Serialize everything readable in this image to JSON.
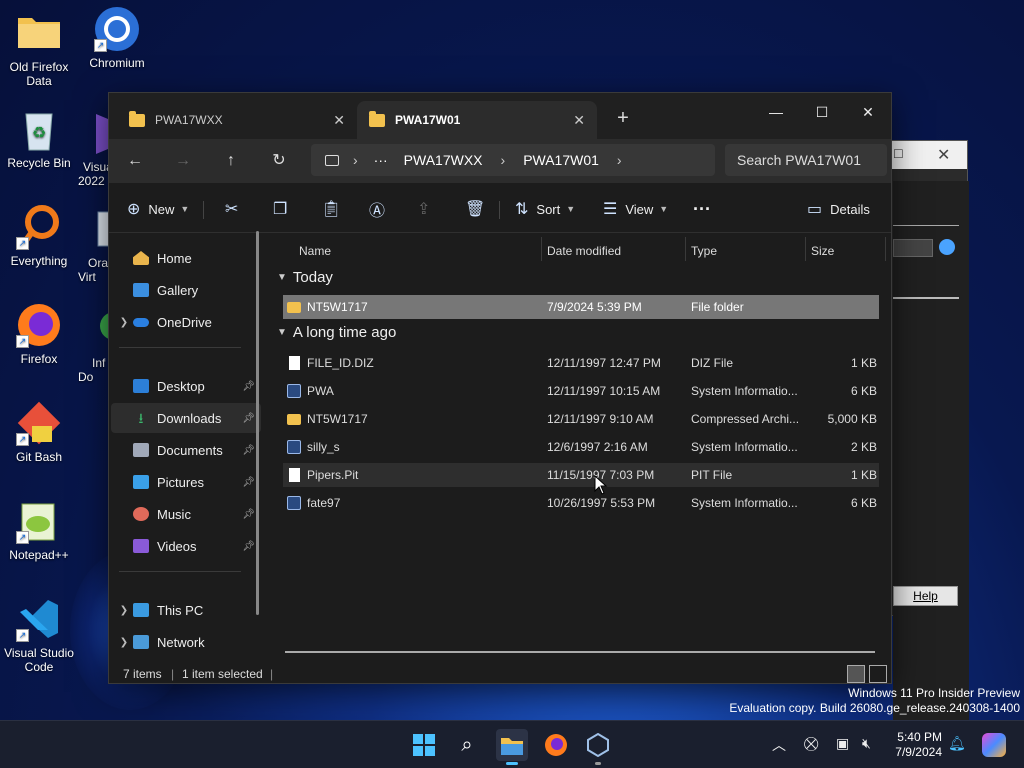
{
  "desktop": {
    "icons": [
      {
        "label": "Old Firefox Data",
        "icon": "folder-icon"
      },
      {
        "label": "Chromium",
        "icon": "chromium-icon"
      },
      {
        "label": "Recycle Bin",
        "icon": "recycle-bin-icon"
      },
      {
        "label": "Visua 2022",
        "icon": "visual-studio-icon"
      },
      {
        "label": "Everything",
        "icon": "everything-search-icon"
      },
      {
        "label": "Ora Virt",
        "icon": "virtualbox-icon"
      },
      {
        "label": "Firefox",
        "icon": "firefox-icon"
      },
      {
        "label": "Inf Do",
        "icon": "app-icon"
      },
      {
        "label": "Git Bash",
        "icon": "git-bash-icon"
      },
      {
        "label": "Notepad++",
        "icon": "notepad-plus-plus-icon"
      },
      {
        "label": "Visual Studio Code",
        "icon": "vscode-icon"
      }
    ]
  },
  "explorer": {
    "tabs": [
      {
        "label": "PWA17WXX",
        "active": false
      },
      {
        "label": "PWA17W01",
        "active": true
      }
    ],
    "new_tab": "+",
    "window_controls": {
      "minimize": "—",
      "maximize": "☐",
      "close": "✕"
    },
    "nav": {
      "back": "←",
      "forward": "→",
      "up": "↑",
      "refresh": "↻"
    },
    "address": {
      "overflow": "···",
      "segments": [
        "PWA17WXX",
        "PWA17W01"
      ],
      "separator": "›"
    },
    "search": {
      "placeholder": "Search PWA17W01"
    },
    "toolbar": {
      "new_label": "New",
      "sort_label": "Sort",
      "view_label": "View",
      "more_label": "···",
      "details_label": "Details"
    },
    "sidebar": {
      "items": [
        {
          "label": "Home",
          "expandable": false,
          "pinned": false
        },
        {
          "label": "Gallery",
          "expandable": false,
          "pinned": false
        },
        {
          "label": "OneDrive",
          "expandable": true,
          "pinned": false
        },
        {
          "label": "Desktop",
          "expandable": false,
          "pinned": true
        },
        {
          "label": "Downloads",
          "expandable": false,
          "pinned": true,
          "selected": true
        },
        {
          "label": "Documents",
          "expandable": false,
          "pinned": true
        },
        {
          "label": "Pictures",
          "expandable": false,
          "pinned": true
        },
        {
          "label": "Music",
          "expandable": false,
          "pinned": true
        },
        {
          "label": "Videos",
          "expandable": false,
          "pinned": true
        },
        {
          "label": "This PC",
          "expandable": true,
          "pinned": false
        },
        {
          "label": "Network",
          "expandable": true,
          "pinned": false
        }
      ]
    },
    "columns": [
      "Name",
      "Date modified",
      "Type",
      "Size"
    ],
    "groups": [
      {
        "label": "Today",
        "rows": [
          {
            "name": "NT5W1717",
            "date": "7/9/2024 5:39 PM",
            "type": "File folder",
            "size": "",
            "icon": "folder-icon",
            "state": "selected"
          }
        ]
      },
      {
        "label": "A long time ago",
        "rows": [
          {
            "name": "FILE_ID.DIZ",
            "date": "12/11/1997 12:47 PM",
            "type": "DIZ File",
            "size": "1 KB",
            "icon": "file-icon"
          },
          {
            "name": "PWA",
            "date": "12/11/1997 10:15 AM",
            "type": "System Informatio...",
            "size": "6 KB",
            "icon": "system-info-icon"
          },
          {
            "name": "NT5W1717",
            "date": "12/11/1997 9:10 AM",
            "type": "Compressed Archi...",
            "size": "5,000 KB",
            "icon": "zip-folder-icon"
          },
          {
            "name": "silly_s",
            "date": "12/6/1997 2:16 AM",
            "type": "System Informatio...",
            "size": "2 KB",
            "icon": "system-info-icon"
          },
          {
            "name": "Pipers.Pit",
            "date": "11/15/1997 7:03 PM",
            "type": "PIT File",
            "size": "1 KB",
            "icon": "file-icon",
            "state": "hover"
          },
          {
            "name": "fate97",
            "date": "10/26/1997 5:53 PM",
            "type": "System Informatio...",
            "size": "6 KB",
            "icon": "system-info-icon"
          }
        ]
      }
    ],
    "status": {
      "items": "7 items",
      "selected": "1 item selected"
    }
  },
  "background_dialog": {
    "help_label": "Help"
  },
  "watermark": {
    "line1": "Windows 11 Pro Insider Preview",
    "line2": "Evaluation copy. Build 26080.ge_release.240308-1400"
  },
  "taskbar": {
    "apps": [
      "start-icon",
      "search-icon",
      "file-explorer-icon",
      "firefox-icon",
      "virtualbox-icon"
    ],
    "clock": {
      "time": "5:40 PM",
      "date": "7/9/2024"
    }
  },
  "colors": {
    "folder": "#f2c14e",
    "accent": "#4aa3ff",
    "selection": "#777777"
  }
}
